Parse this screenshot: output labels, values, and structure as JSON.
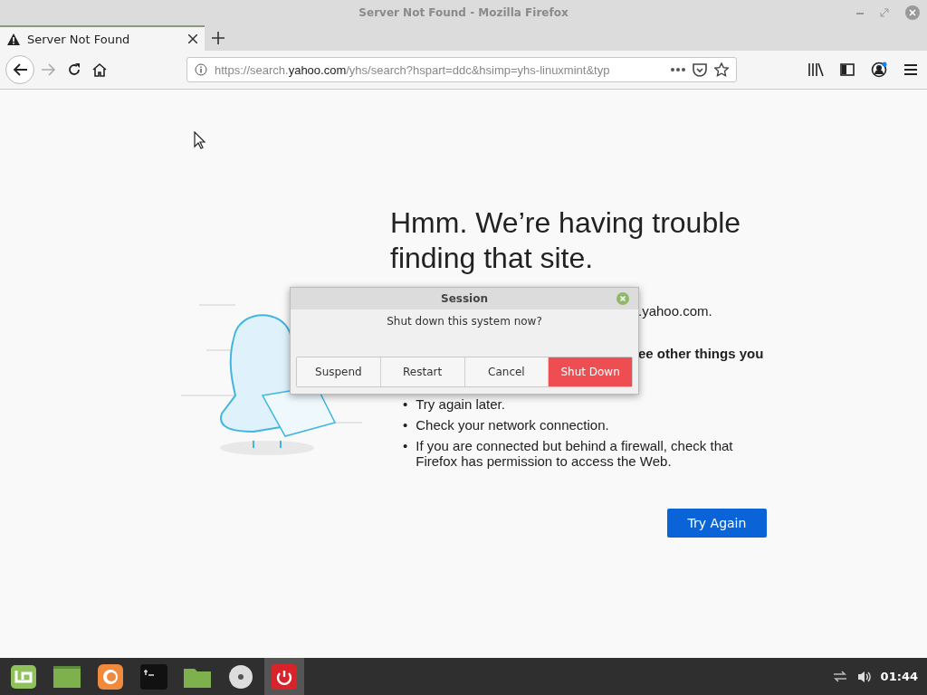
{
  "window": {
    "title": "Server Not Found - Mozilla Firefox"
  },
  "tabs": [
    {
      "label": "Server Not Found",
      "selected": true
    }
  ],
  "url": {
    "prefix": "https://search.",
    "domain": "yahoo.com",
    "path": "/yhs/search?hspart=ddc&hsimp=yhs-linuxmint&typ"
  },
  "page": {
    "heading": "Hmm. We’re having trouble finding that site.",
    "line_fragment": ".yahoo.com.",
    "bold_fragment": "ee other things you",
    "bullets": [
      {
        "marker": "•",
        "text": "Try again later."
      },
      {
        "marker": "•",
        "text": "Check your network connection."
      },
      {
        "marker": "•",
        "text": "If you are connected but behind a firewall, check that Firefox has permission to access the Web."
      }
    ],
    "button": "Try Again"
  },
  "dialog": {
    "title": "Session",
    "message": "Shut down this system now?",
    "buttons": [
      {
        "label": "Suspend",
        "kind": "default"
      },
      {
        "label": "Restart",
        "kind": "default"
      },
      {
        "label": "Cancel",
        "kind": "default"
      },
      {
        "label": "Shut Down",
        "kind": "destructive"
      }
    ]
  },
  "taskbar": {
    "items": [
      {
        "kind": "menu",
        "selected": false
      },
      {
        "kind": "desktop",
        "selected": false
      },
      {
        "kind": "browser",
        "selected": false
      },
      {
        "kind": "terminal",
        "selected": false
      },
      {
        "kind": "folder",
        "selected": false
      },
      {
        "kind": "disc",
        "selected": false
      },
      {
        "kind": "power",
        "selected": true
      }
    ],
    "clock": "01:44"
  }
}
